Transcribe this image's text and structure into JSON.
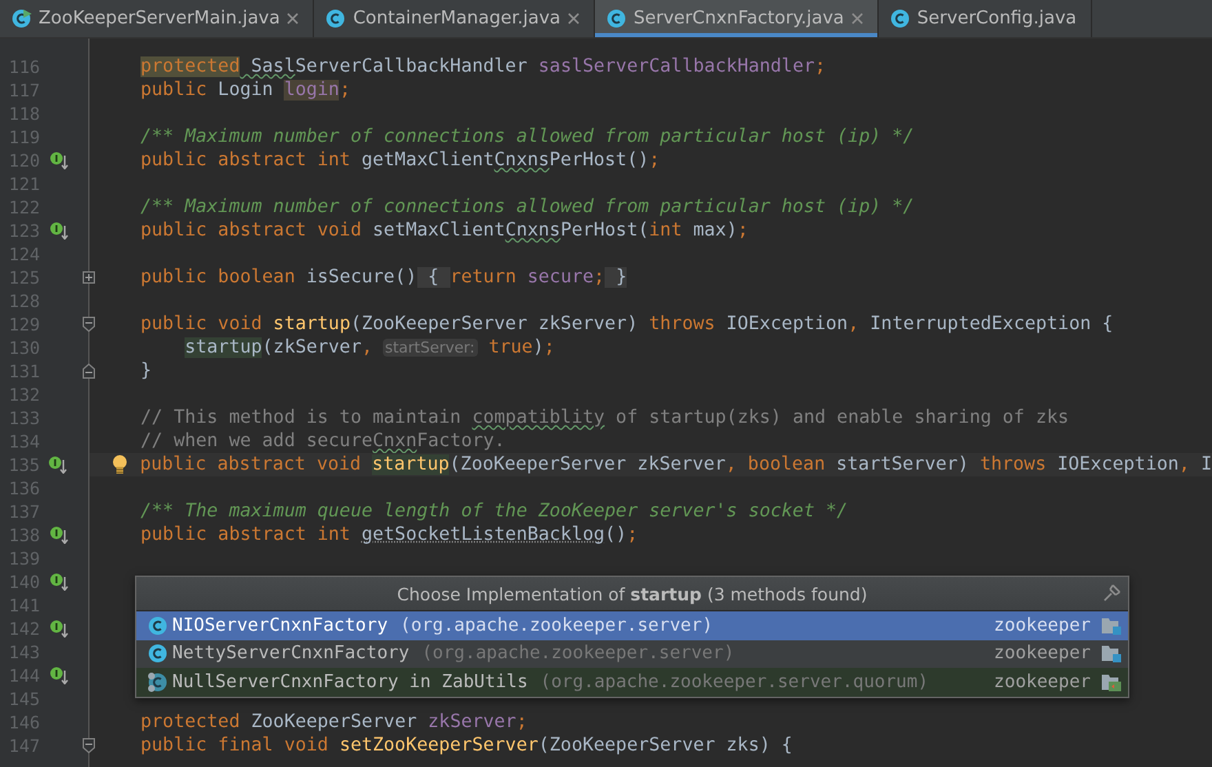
{
  "tabs": [
    {
      "label": "ZooKeeperServerMain.java",
      "kind": "main-class",
      "closable": true,
      "selected": false
    },
    {
      "label": "ContainerManager.java",
      "kind": "class",
      "closable": true,
      "selected": false
    },
    {
      "label": "ServerCnxnFactory.java",
      "kind": "class",
      "closable": true,
      "selected": true
    },
    {
      "label": "ServerConfig.java",
      "kind": "class",
      "selected": false
    }
  ],
  "editor": {
    "lines": [
      {
        "number": "116",
        "tokens": [
          {
            "kind": "keyword",
            "t": "protected",
            "highlighted": true
          },
          {
            "kind": "plain",
            "t": " Sasl",
            "misspelled": true
          },
          {
            "kind": "plain",
            "t": "ServerCallbackHandler "
          },
          {
            "kind": "field",
            "t": "saslServerCallbackHandler"
          },
          {
            "kind": "keyword",
            "t": ";"
          }
        ]
      },
      {
        "number": "117",
        "tokens": [
          {
            "kind": "keyword",
            "t": "public "
          },
          {
            "kind": "plain",
            "t": "Login "
          },
          {
            "kind": "field",
            "t": "login",
            "highlighted": true
          },
          {
            "kind": "keyword",
            "t": ";"
          }
        ]
      },
      {
        "number": "118"
      },
      {
        "number": "119",
        "tokens": [
          {
            "kind": "doc",
            "t": "/** Maximum number of connections allowed from particular host (ip) */"
          }
        ]
      },
      {
        "number": "120",
        "gutter": [
          {
            "kind": "implemented"
          }
        ],
        "tokens": [
          {
            "kind": "keyword",
            "t": "public abstract int "
          },
          {
            "kind": "plain",
            "t": "getMaxClient"
          },
          {
            "kind": "plain",
            "t": "Cnxns",
            "misspelled": true
          },
          {
            "kind": "plain",
            "t": "PerHost()"
          },
          {
            "kind": "keyword",
            "t": ";"
          }
        ]
      },
      {
        "number": "121"
      },
      {
        "number": "122",
        "tokens": [
          {
            "kind": "doc",
            "t": "/** Maximum number of connections allowed from particular host (ip) */"
          }
        ]
      },
      {
        "number": "123",
        "gutter": [
          {
            "kind": "implemented"
          }
        ],
        "tokens": [
          {
            "kind": "keyword",
            "t": "public abstract void "
          },
          {
            "kind": "plain",
            "t": "setMaxClient"
          },
          {
            "kind": "plain",
            "t": "Cnxns",
            "misspelled": true
          },
          {
            "kind": "plain",
            "t": "PerHost("
          },
          {
            "kind": "keyword",
            "t": "int "
          },
          {
            "kind": "plain",
            "t": "max)"
          },
          {
            "kind": "keyword",
            "t": ";"
          }
        ]
      },
      {
        "number": "124"
      },
      {
        "number": "125",
        "gutter": [
          {
            "kind": "fold-collapsed"
          }
        ],
        "tokens": [
          {
            "kind": "keyword",
            "t": "public boolean "
          },
          {
            "kind": "plain",
            "t": "isSecure()"
          },
          {
            "kind": "folded",
            "t": " { "
          },
          {
            "kind": "keyword",
            "t": "return "
          },
          {
            "kind": "field",
            "t": "secure"
          },
          {
            "kind": "keyword",
            "t": ";"
          },
          {
            "kind": "folded",
            "t": " }"
          }
        ]
      },
      {
        "number": "128"
      },
      {
        "number": "129",
        "gutter": [
          {
            "kind": "fold-start"
          }
        ],
        "tokens": [
          {
            "kind": "keyword",
            "t": "public void "
          },
          {
            "kind": "method",
            "t": "startup"
          },
          {
            "kind": "plain",
            "t": "(ZooKeeperServer zkServer) "
          },
          {
            "kind": "keyword",
            "t": "throws "
          },
          {
            "kind": "plain",
            "t": "IOException"
          },
          {
            "kind": "keyword",
            "t": ", "
          },
          {
            "kind": "plain",
            "t": "InterruptedException {"
          }
        ]
      },
      {
        "number": "130",
        "indented": true,
        "tokens": [
          {
            "kind": "plain",
            "t": "startup",
            "highlighted": true
          },
          {
            "kind": "plain",
            "t": "(zkServer"
          },
          {
            "kind": "keyword",
            "t": ","
          },
          {
            "kind": "hint",
            "t": "startServer:"
          },
          {
            "kind": "keyword",
            "t": "true"
          },
          {
            "kind": "plain",
            "t": ")"
          },
          {
            "kind": "keyword",
            "t": ";"
          }
        ]
      },
      {
        "number": "131",
        "gutter": [
          {
            "kind": "fold-end"
          }
        ],
        "tokens": [
          {
            "kind": "plain",
            "t": "}"
          }
        ]
      },
      {
        "number": "132"
      },
      {
        "number": "133",
        "tokens": [
          {
            "kind": "comment",
            "t": "// This method is to maintain "
          },
          {
            "kind": "comment",
            "t": "compatiblity",
            "misspelled": true
          },
          {
            "kind": "comment",
            "t": " of startup(zks) and enable sharing of zks"
          }
        ]
      },
      {
        "number": "134",
        "tokens": [
          {
            "kind": "comment",
            "t": "// when we add secure"
          },
          {
            "kind": "comment",
            "t": "Cnxn",
            "misspelled": true
          },
          {
            "kind": "comment",
            "t": "Factory."
          }
        ]
      },
      {
        "number": "135",
        "current": true,
        "gutter": [
          {
            "kind": "implemented"
          },
          {
            "kind": "bulb"
          }
        ],
        "tokens": [
          {
            "kind": "keyword",
            "t": "public abstract void "
          },
          {
            "kind": "method",
            "t": "startup",
            "highlighted": true
          },
          {
            "kind": "plain",
            "t": "(ZooKeeperServer zkServer"
          },
          {
            "kind": "keyword",
            "t": ", boolean "
          },
          {
            "kind": "plain",
            "t": "startServer) "
          },
          {
            "kind": "keyword",
            "t": "throws "
          },
          {
            "kind": "plain",
            "t": "IOException"
          },
          {
            "kind": "keyword",
            "t": ", "
          },
          {
            "kind": "plain",
            "t": "I"
          }
        ]
      },
      {
        "number": "136"
      },
      {
        "number": "137",
        "tokens": [
          {
            "kind": "doc",
            "t": "/** The maximum queue length of the ZooKeeper server's socket */"
          }
        ]
      },
      {
        "number": "138",
        "gutter": [
          {
            "kind": "implemented"
          }
        ],
        "tokens": [
          {
            "kind": "keyword",
            "t": "public abstract int "
          },
          {
            "kind": "plain",
            "t": "getSocketListenBacklog",
            "unused": true
          },
          {
            "kind": "plain",
            "t": "()"
          },
          {
            "kind": "keyword",
            "t": ";"
          }
        ]
      },
      {
        "number": "139"
      },
      {
        "number": "140",
        "gutter": [
          {
            "kind": "implemented"
          }
        ]
      },
      {
        "number": "141"
      },
      {
        "number": "142",
        "gutter": [
          {
            "kind": "implemented"
          }
        ]
      },
      {
        "number": "143"
      },
      {
        "number": "144",
        "gutter": [
          {
            "kind": "implemented"
          }
        ]
      },
      {
        "number": "145"
      },
      {
        "number": "146",
        "tokens": [
          {
            "kind": "keyword",
            "t": "protected "
          },
          {
            "kind": "plain",
            "t": "ZooKeeperServer "
          },
          {
            "kind": "field",
            "t": "zkServer"
          },
          {
            "kind": "keyword",
            "t": ";"
          }
        ]
      },
      {
        "number": "147",
        "gutter": [
          {
            "kind": "fold-start"
          }
        ],
        "tokens": [
          {
            "kind": "keyword",
            "t": "public final void "
          },
          {
            "kind": "method",
            "t": "setZooKeeperServer"
          },
          {
            "kind": "plain",
            "t": "(ZooKeeperServer zks) {"
          }
        ]
      }
    ]
  },
  "popup": {
    "title": "Choose Implementation of **startup** (3 methods found)",
    "items": [
      {
        "name": "NIOServerCnxnFactory",
        "location": "(org.apache.zookeeper.server)",
        "module": "zookeeper",
        "kind": "class",
        "test": false,
        "selected": true
      },
      {
        "name": "NettyServerCnxnFactory",
        "location": "(org.apache.zookeeper.server)",
        "module": "zookeeper",
        "kind": "class",
        "test": false,
        "selected": false
      },
      {
        "name": "NullServerCnxnFactory in ZabUtils",
        "location": "(org.apache.zookeeper.server.quorum)",
        "module": "zookeeper",
        "kind": "inner-class",
        "test": true,
        "selected": false
      }
    ]
  }
}
